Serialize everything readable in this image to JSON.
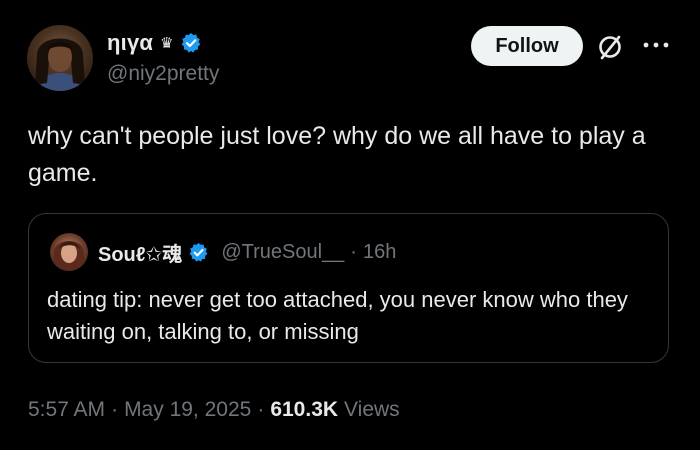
{
  "author": {
    "display_name": "ηιγα",
    "crown_icon": "crown-icon",
    "verified": true,
    "handle": "@niy2pretty"
  },
  "actions": {
    "follow_label": "Follow",
    "grok_icon": "grok-icon",
    "more_icon": "more-icon"
  },
  "tweet": {
    "text": "why can't people just love? why do we all have to play a game."
  },
  "quoted_tweet": {
    "display_name": "Souℓ✩魂",
    "verified": true,
    "handle": "@TrueSoul__",
    "separator": "·",
    "time": "16h",
    "text": "dating tip: never get too attached, you never know who they waiting on, talking to, or missing"
  },
  "meta": {
    "time": "5:57 AM",
    "separator_1": "·",
    "date": "May 19, 2025",
    "separator_2": "·",
    "views_count": "610.3K",
    "views_label": "Views"
  },
  "colors": {
    "background": "#000000",
    "primary_text": "#e7e9ea",
    "secondary_text": "#71767b",
    "verified_blue": "#1d9bf0",
    "follow_button_bg": "#eff3f4",
    "quote_border": "#333639"
  }
}
